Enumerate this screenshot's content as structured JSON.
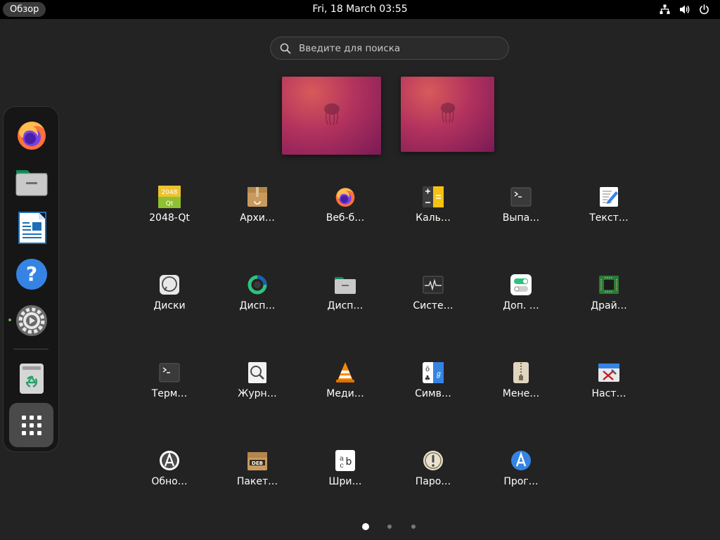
{
  "topbar": {
    "activities_label": "Обзор",
    "clock": "Fri, 18 March  03:55",
    "tray_icons": [
      "network-icon",
      "volume-icon",
      "power-icon"
    ]
  },
  "search": {
    "placeholder": "Введите для поиска"
  },
  "workspaces": [
    {
      "name": "workspace-1"
    },
    {
      "name": "workspace-2"
    }
  ],
  "dock": {
    "items": [
      {
        "name": "firefox",
        "icon": "firefox-icon"
      },
      {
        "name": "files",
        "icon": "files-icon"
      },
      {
        "name": "libreoffice-writer",
        "icon": "writer-icon"
      },
      {
        "name": "help",
        "icon": "help-icon"
      },
      {
        "name": "settings",
        "icon": "settings-icon",
        "running": true
      },
      {
        "name": "trash",
        "icon": "trash-icon"
      },
      {
        "name": "show-apps",
        "icon": "app-grid-icon"
      }
    ]
  },
  "apps": [
    {
      "label": "2048-Qt",
      "icon": "game-2048-icon"
    },
    {
      "label": "Архи…",
      "icon": "archive-manager-icon"
    },
    {
      "label": "Веб-б…",
      "icon": "firefox-icon"
    },
    {
      "label": "Каль…",
      "icon": "calculator-icon"
    },
    {
      "label": "Выпа…",
      "icon": "terminal-dropdown-icon"
    },
    {
      "label": "Текст…",
      "icon": "text-editor-icon"
    },
    {
      "label": "Диски",
      "icon": "disks-icon"
    },
    {
      "label": "Дисп…",
      "icon": "disk-usage-icon"
    },
    {
      "label": "Дисп…",
      "icon": "file-manager-icon"
    },
    {
      "label": "Систе…",
      "icon": "system-monitor-icon"
    },
    {
      "label": "Доп. …",
      "icon": "extensions-icon"
    },
    {
      "label": "Драй…",
      "icon": "drivers-icon"
    },
    {
      "label": "Терм…",
      "icon": "terminal-icon"
    },
    {
      "label": "Журн…",
      "icon": "logs-icon"
    },
    {
      "label": "Меди…",
      "icon": "vlc-icon"
    },
    {
      "label": "Симв…",
      "icon": "characters-icon"
    },
    {
      "label": "Мене…",
      "icon": "archive-zip-icon"
    },
    {
      "label": "Наст…",
      "icon": "tweaks-icon"
    },
    {
      "label": "Обно…",
      "icon": "software-updater-icon"
    },
    {
      "label": "Пакет…",
      "icon": "deb-installer-icon"
    },
    {
      "label": "Шри…",
      "icon": "fonts-icon"
    },
    {
      "label": "Паро…",
      "icon": "passwords-icon"
    },
    {
      "label": "Прог…",
      "icon": "software-center-icon"
    }
  ],
  "pager": {
    "pages": 3,
    "current": 1
  },
  "colors": {
    "background": "#232323",
    "topbar": "#000000",
    "dock": "#161616",
    "accent_running": "#6ab04c"
  }
}
